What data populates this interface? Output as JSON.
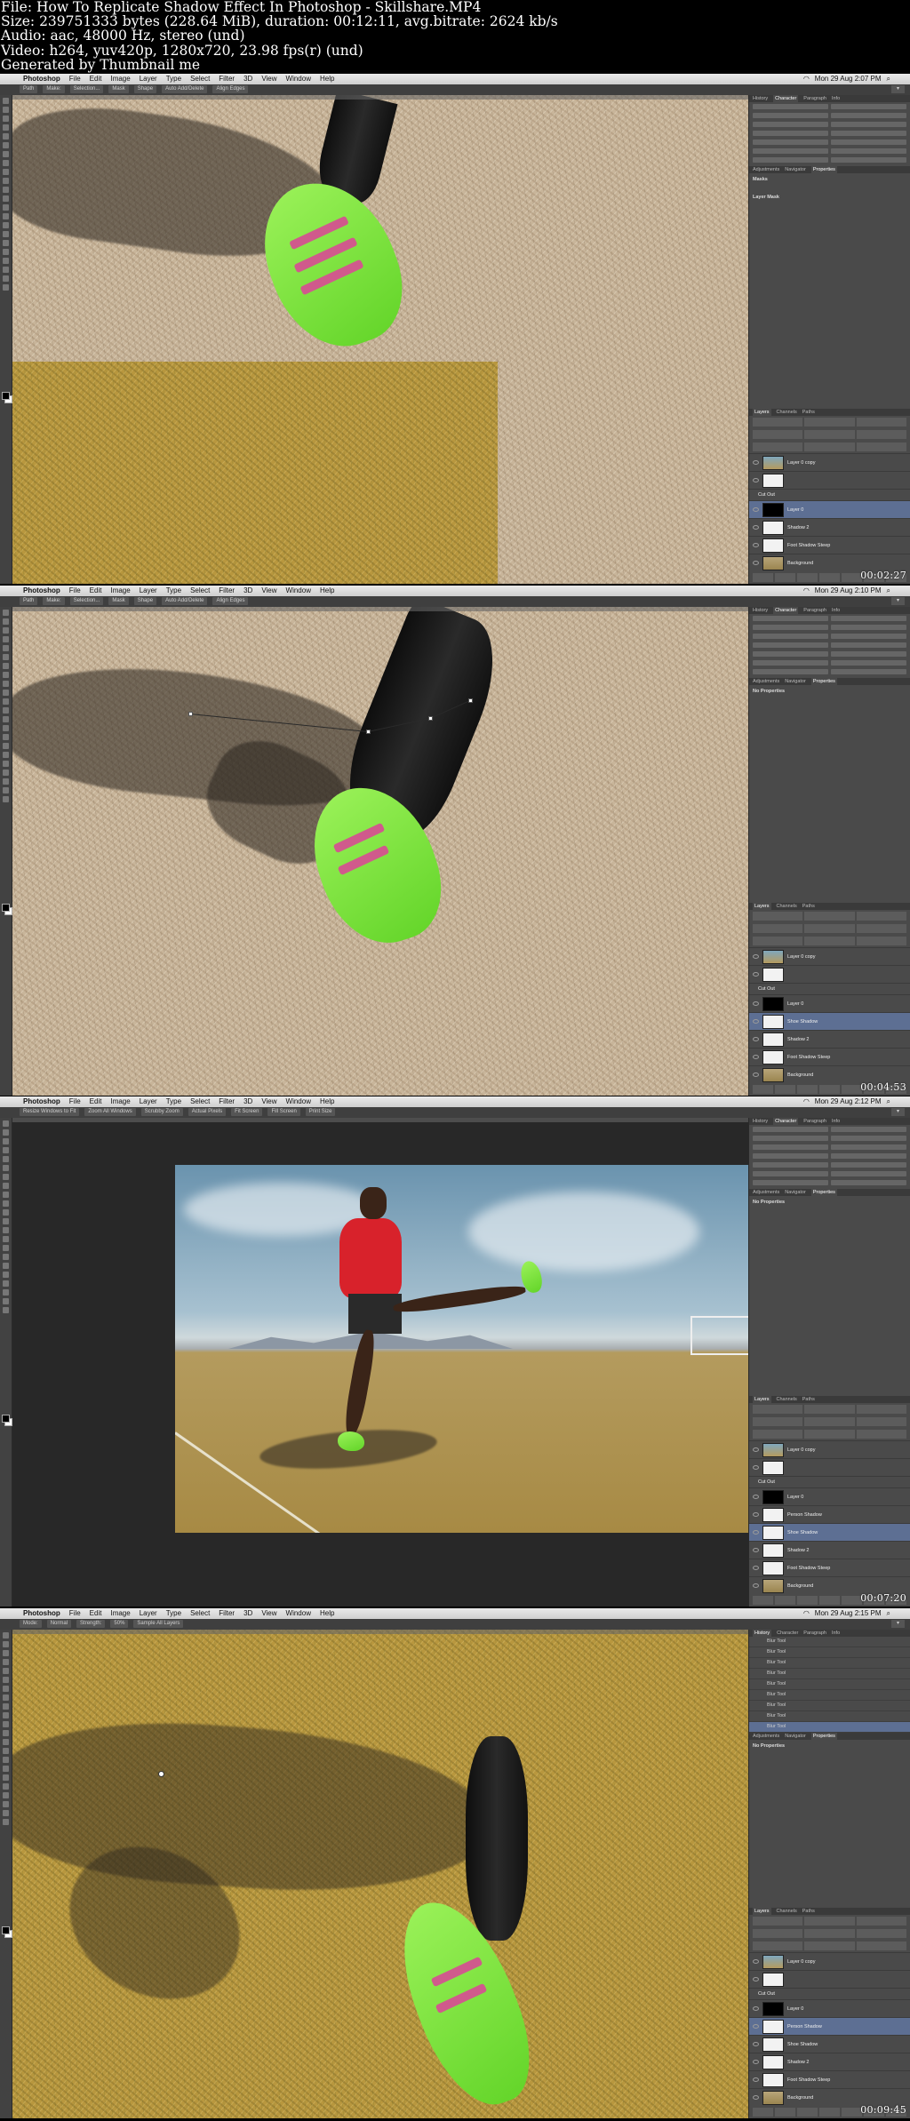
{
  "meta": {
    "lines": [
      "File: How To Replicate Shadow Effect In Photoshop - Skillshare.MP4",
      "Size: 239751333 bytes (228.64 MiB), duration: 00:12:11, avg.bitrate: 2624 kb/s",
      "Audio: aac, 48000 Hz, stereo (und)",
      "Video: h264, yuv420p, 1280x720, 23.98 fps(r) (und)",
      "Generated by Thumbnail me"
    ]
  },
  "menubar": {
    "apple": "",
    "menus": [
      "Photoshop",
      "File",
      "Edit",
      "Image",
      "Layer",
      "Type",
      "Select",
      "Filter",
      "3D",
      "View",
      "Window",
      "Help"
    ]
  },
  "panels": {
    "top_tabs": [
      "History",
      "Character",
      "Paragraph",
      "Info"
    ],
    "mid_tabs": [
      "Adjustments",
      "Navigator",
      "Properties"
    ],
    "no_properties": "No Properties",
    "layer_tabs": [
      "Layers",
      "Channels",
      "Paths"
    ]
  },
  "frames": [
    {
      "time": "Mon 29 Aug  2:07 PM",
      "timecode": "00:02:27",
      "options": [
        "Path",
        "Make:",
        "Selection...",
        "Mask",
        "Shape",
        "Auto Add/Delete",
        "Align Edges"
      ],
      "props_title": "Masks",
      "props_sub": "Layer Mask",
      "layers": [
        {
          "name": "Layer 0 copy",
          "thumb": "t-sky",
          "sel": false
        },
        {
          "name": "",
          "thumb": "t-white",
          "sel": false
        },
        {
          "name": "Cut Out",
          "group": true
        },
        {
          "name": "Layer 0",
          "thumb": "t-mask",
          "sel": true
        },
        {
          "name": "Shadow 2",
          "thumb": "t-white",
          "sel": false
        },
        {
          "name": "Foot Shadow Steep",
          "thumb": "t-white",
          "sel": false
        },
        {
          "name": "Background",
          "thumb": "t-grass",
          "sel": false
        }
      ]
    },
    {
      "time": "Mon 29 Aug  2:10 PM",
      "timecode": "00:04:53",
      "options": [
        "Path",
        "Make:",
        "Selection...",
        "Mask",
        "Shape",
        "Auto Add/Delete",
        "Align Edges"
      ],
      "layers": [
        {
          "name": "Layer 0 copy",
          "thumb": "t-sky",
          "sel": false
        },
        {
          "name": "",
          "thumb": "t-white",
          "sel": false
        },
        {
          "name": "Cut Out",
          "group": true
        },
        {
          "name": "Layer 0",
          "thumb": "t-mask",
          "sel": false
        },
        {
          "name": "Shoe Shadow",
          "thumb": "t-white",
          "sel": true
        },
        {
          "name": "Shadow 2",
          "thumb": "t-white",
          "sel": false
        },
        {
          "name": "Foot Shadow Steep",
          "thumb": "t-white",
          "sel": false
        },
        {
          "name": "Background",
          "thumb": "t-grass",
          "sel": false
        }
      ]
    },
    {
      "time": "Mon 29 Aug  2:12 PM",
      "timecode": "00:07:20",
      "options": [
        "Resize Windows to Fit",
        "Zoom All Windows",
        "Scrubby Zoom",
        "Actual Pixels",
        "Fit Screen",
        "Fill Screen",
        "Print Size"
      ],
      "layers": [
        {
          "name": "Layer 0 copy",
          "thumb": "t-sky",
          "sel": false
        },
        {
          "name": "",
          "thumb": "t-white",
          "sel": false
        },
        {
          "name": "Cut Out",
          "group": true
        },
        {
          "name": "Layer 0",
          "thumb": "t-mask",
          "sel": false
        },
        {
          "name": "Person Shadow",
          "thumb": "t-white",
          "sel": false
        },
        {
          "name": "Shoe Shadow",
          "thumb": "t-white",
          "sel": true
        },
        {
          "name": "Shadow 2",
          "thumb": "t-white",
          "sel": false
        },
        {
          "name": "Foot Shadow Steep",
          "thumb": "t-white",
          "sel": false
        },
        {
          "name": "Background",
          "thumb": "t-grass",
          "sel": false
        }
      ]
    },
    {
      "time": "Mon 29 Aug  2:15 PM",
      "timecode": "00:09:45",
      "options": [
        "Mode:",
        "Normal",
        "Strength:",
        "50%",
        "Sample All Layers"
      ],
      "history": [
        "Blur Tool",
        "Blur Tool",
        "Blur Tool",
        "Blur Tool",
        "Blur Tool",
        "Blur Tool",
        "Blur Tool",
        "Blur Tool",
        "Blur Tool"
      ],
      "layers": [
        {
          "name": "Layer 0 copy",
          "thumb": "t-sky",
          "sel": false
        },
        {
          "name": "",
          "thumb": "t-white",
          "sel": false
        },
        {
          "name": "Cut Out",
          "group": true
        },
        {
          "name": "Layer 0",
          "thumb": "t-mask",
          "sel": false
        },
        {
          "name": "Person Shadow",
          "thumb": "t-white",
          "sel": true
        },
        {
          "name": "Shoe Shadow",
          "thumb": "t-white",
          "sel": false
        },
        {
          "name": "Shadow 2",
          "thumb": "t-white",
          "sel": false
        },
        {
          "name": "Foot Shadow Steep",
          "thumb": "t-white",
          "sel": false
        },
        {
          "name": "Background",
          "thumb": "t-grass",
          "sel": false
        }
      ]
    }
  ]
}
